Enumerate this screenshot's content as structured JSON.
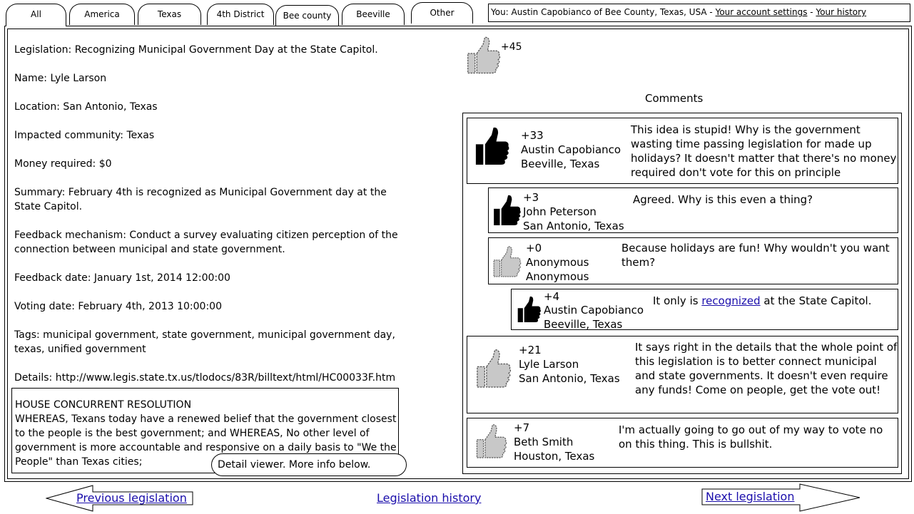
{
  "tabs": [
    {
      "label": "All",
      "active": true
    },
    {
      "label": "America",
      "active": false
    },
    {
      "label": "Texas",
      "active": false
    },
    {
      "label": "4th District",
      "active": false
    },
    {
      "label": "Bee county",
      "active": false
    },
    {
      "label": "Beeville",
      "active": false
    },
    {
      "label": "Other",
      "active": false
    }
  ],
  "user_bar": {
    "prefix": "You: Austin Capobianco of Bee County, Texas, USA - ",
    "settings_link": "Your account settings",
    "separator": " - ",
    "history_link": "Your history"
  },
  "legislation": {
    "title": "Legislation: Recognizing Municipal Government Day at the State Capitol.",
    "name": "Name: Lyle Larson",
    "location": "Location: San Antonio, Texas",
    "impacted": "Impacted community: Texas",
    "money": "Money required: $0",
    "summary": "Summary: February 4th is recognized as Municipal Government day at the State Capitol.",
    "feedback_mechanism": "Feedback mechanism: Conduct a survey evaluating citizen perception of the connection between municipal and state government.",
    "feedback_date": "Feedback date: January 1st, 2014 12:00:00",
    "voting_date": "Voting date: February 4th, 2013 10:00:00",
    "tags": "Tags: municipal government, state government, municipal government day, texas, unified government",
    "details": "Details: http://www.legis.state.tx.us/tlodocs/83R/billtext/html/HC00033F.htm",
    "bill_heading": "HOUSE CONCURRENT RESOLUTION",
    "bill_text": "WHEREAS, Texans today have a renewed belief that the government closest to the people is the best government; and WHEREAS, No other level of government is more accountable and responsive on a daily basis to \"We the People\" than Texas cities;",
    "detail_viewer": "Detail viewer. More info below.",
    "vote_score": "+45"
  },
  "comments_title": "Comments",
  "comments": [
    {
      "score": "+33",
      "name": "Austin Capobianco",
      "location": "Beeville, Texas",
      "text": "This idea is stupid! Why is the government wasting time passing legislation for made up holidays? It doesn't matter that there's no money required don't vote for this on principle",
      "voted": true
    },
    {
      "score": "+3",
      "name": "John Peterson",
      "location": "San Antonio, Texas",
      "text": "Agreed. Why is this even a thing?",
      "voted": true
    },
    {
      "score": "+0",
      "name": "Anonymous",
      "location": "Anonymous",
      "text": "Because holidays are fun! Why wouldn't you want them?",
      "voted": false
    },
    {
      "score": "+4",
      "name": "Austin Capobianco",
      "location": "Beeville, Texas",
      "text_before": "It only is ",
      "text_link": "recognized",
      "text_after": " at the State Capitol.",
      "voted": true
    },
    {
      "score": "+21",
      "name": "Lyle Larson",
      "location": "San Antonio, Texas",
      "text": "It says right in the details that the whole point of this legislation is to better connect municipal and state governments. It doesn't even require any funds! Come on people, get the vote out!",
      "voted": false
    },
    {
      "score": "+7",
      "name": "Beth Smith",
      "location": "Houston, Texas",
      "text": "I'm actually going to go out of my way to vote no on this thing. This is bullshit.",
      "voted": false
    }
  ],
  "nav": {
    "previous": "Previous legislation",
    "history": "Legislation history",
    "next": "Next legislation"
  },
  "colors": {
    "voted": "#000000",
    "not_voted": "#c8c8c8",
    "link": "#1a0dab"
  }
}
